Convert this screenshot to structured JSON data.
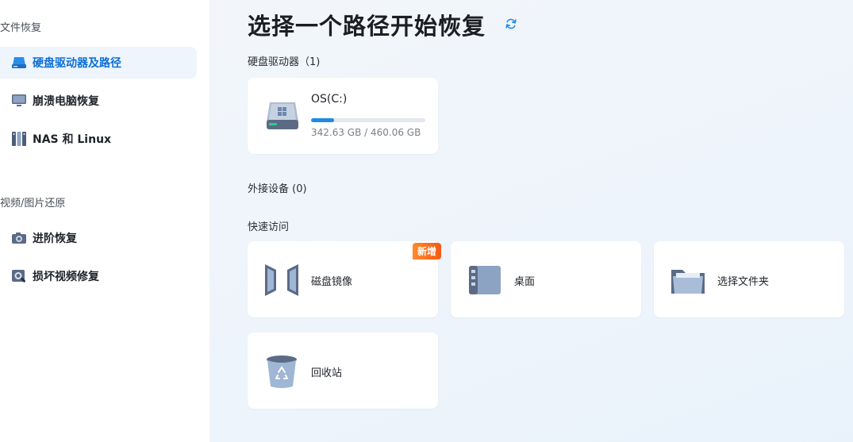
{
  "sidebar": {
    "section_file_recovery": "文件恢复",
    "section_video_photo": "视频/图片还原",
    "items": [
      {
        "label": "硬盘驱动器及路径",
        "icon": "drive-icon",
        "active": true
      },
      {
        "label": "崩溃电脑恢复",
        "icon": "monitor-icon",
        "active": false
      },
      {
        "label": "NAS 和 Linux",
        "icon": "nas-icon",
        "active": false
      },
      {
        "label": "进阶恢复",
        "icon": "camera-icon",
        "active": false
      },
      {
        "label": "损坏视频修复",
        "icon": "video-repair-icon",
        "active": false
      }
    ]
  },
  "main": {
    "title": "选择一个路径开始恢复",
    "drives_label": "硬盘驱动器（1)",
    "external_label": "外接设备 (0)",
    "quick_label": "快速访问",
    "drive": {
      "name": "OS(C:)",
      "size": "342.63 GB / 460.06 GB",
      "used_fraction": 0.2
    },
    "quick_access": [
      {
        "label": "磁盘镜像",
        "icon": "disk-image-icon",
        "badge": "新增"
      },
      {
        "label": "桌面",
        "icon": "desktop-icon"
      },
      {
        "label": "选择文件夹",
        "icon": "folder-icon"
      },
      {
        "label": "回收站",
        "icon": "recycle-bin-icon"
      }
    ]
  },
  "colors": {
    "accent": "#0b6fd9",
    "active_bg": "#eef5fd",
    "badge": "#f45a16",
    "progress": "#1f8ae8"
  }
}
